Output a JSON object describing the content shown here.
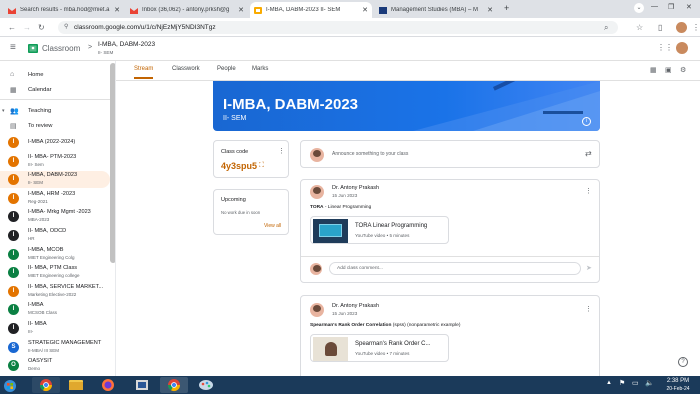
{
  "browser": {
    "tabs": [
      {
        "title": "Search results - mba.hod@miet.a",
        "icon": "gmail-icon",
        "active": false
      },
      {
        "title": "Inbox (36,062) - antony.prksh@g",
        "icon": "gmail-icon",
        "active": false
      },
      {
        "title": "I-MBA, DABM-2023 II- SEM",
        "icon": "classroom-icon",
        "active": true
      },
      {
        "title": "Management Studies (MBA) – M",
        "icon": "miet-icon",
        "active": false
      }
    ],
    "new_tab": "+",
    "url": "classroom.google.com/u/1/c/NjEzMjY5NDI3NTgz"
  },
  "app": {
    "name": "Classroom",
    "breadcrumb_sep": ">",
    "class_title": "I-MBA, DABM-2023",
    "class_section": "II- SEM"
  },
  "tabs": [
    "Stream",
    "Classwork",
    "People",
    "Marks"
  ],
  "sidebar": {
    "home": "Home",
    "calendar": "Calendar",
    "teaching": "Teaching",
    "to_review": "To review",
    "classes": [
      {
        "initial": "I",
        "name": "I-MBA (2022-2024)",
        "sub": "",
        "color": "#e37400"
      },
      {
        "initial": "I",
        "name": "II- MBA- PTM-2023",
        "sub": "III- Sem",
        "color": "#e37400"
      },
      {
        "initial": "I",
        "name": "I-MBA, DABM-2023",
        "sub": "II- SEM",
        "color": "#e37400"
      },
      {
        "initial": "I",
        "name": "I-MBA, HRM -2023",
        "sub": "Reg-2021",
        "color": "#e37400"
      },
      {
        "initial": "I",
        "name": "I-MBA- Mrkg Mgmt -2023",
        "sub": "MBA-2023",
        "color": "#202124"
      },
      {
        "initial": "I",
        "name": "II- MBA, ODCD",
        "sub": "HR",
        "color": "#202124"
      },
      {
        "initial": "I",
        "name": "I-MBA, MCOB",
        "sub": "MIET Engineering Colg",
        "color": "#0b8043"
      },
      {
        "initial": "I",
        "name": "II- MBA, PTM Class",
        "sub": "MIET Engineering college",
        "color": "#0b8043"
      },
      {
        "initial": "I",
        "name": "II- MBA, SERVICE MARKET...",
        "sub": "Marketing Elective-2022",
        "color": "#e37400"
      },
      {
        "initial": "I",
        "name": "I-MBA",
        "sub": "MCSOB Class",
        "color": "#0b8043"
      },
      {
        "initial": "I",
        "name": "II- MBA",
        "sub": "III-",
        "color": "#202124"
      },
      {
        "initial": "S",
        "name": "STRATEGIC MANAGEMENT",
        "sub": "II-MBA/ III SEM",
        "color": "#1967d2"
      },
      {
        "initial": "O",
        "name": "OASYSIT",
        "sub": "Demo",
        "color": "#0b8043"
      }
    ]
  },
  "banner": {
    "title": "I-MBA, DABM-2023",
    "subtitle": "II- SEM"
  },
  "class_code": {
    "label": "Class code",
    "code": "4y3spu5"
  },
  "upcoming": {
    "title": "Upcoming",
    "empty": "No work due in soon",
    "view_all": "View all"
  },
  "announce": {
    "placeholder": "Announce something to your class"
  },
  "posts": [
    {
      "author": "Dr. Antony Prakash",
      "date": "15 Jun 2023",
      "title_bold": "TORA",
      "title_rest": " - Linear Programming",
      "attachment_title": "TORA Linear Programming",
      "attachment_meta": "YouTube video • 5 minutes",
      "comment_placeholder": "Add class comment..."
    },
    {
      "author": "Dr. Antony Prakash",
      "date": "15 Jun 2023",
      "title_bold": "Spearman's Rank Order Correlation",
      "title_rest": " (spss) (nonparametric example)",
      "attachment_title": "Spearman's Rank Order C...",
      "attachment_meta": "YouTube video • 7 minutes"
    }
  ],
  "taskbar": {
    "time": "2:38 PM",
    "date": "20-Feb-24"
  },
  "colors": {
    "accent": "#c26401",
    "banner": "#1a73e8",
    "classroom_green": "#0f9d58"
  }
}
